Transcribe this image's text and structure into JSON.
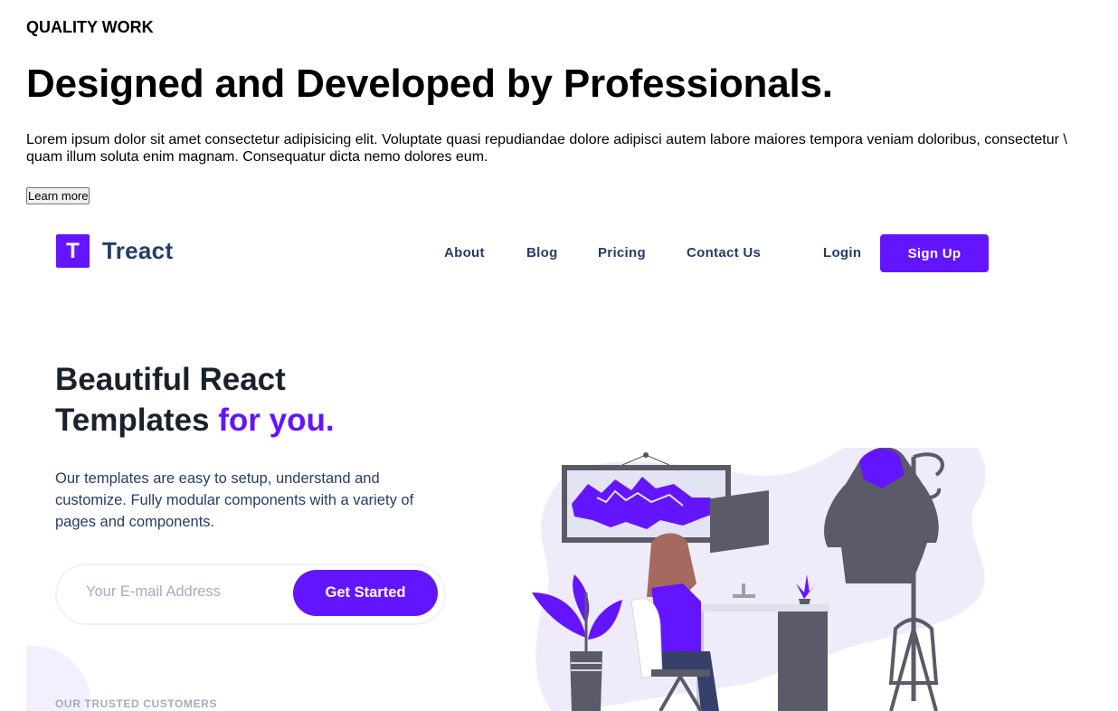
{
  "top": {
    "eyebrow": "QUALITY WORK",
    "heading": "Designed and Developed by Professionals.",
    "paragraph": "Lorem ipsum dolor sit amet consectetur adipisicing elit. Voluptate quasi repudiandae dolore adipisci autem labore maiores tempora veniam doloribus, consectetur \\ quam illum soluta enim magnam. Consequatur dicta nemo dolores eum.",
    "button": "Learn more"
  },
  "header": {
    "logo_letter": "T",
    "brand": "Treact",
    "nav": [
      "About",
      "Blog",
      "Pricing",
      "Contact Us"
    ],
    "login": "Login",
    "signup": "Sign Up"
  },
  "hero": {
    "title_line1": "Beautiful React",
    "title_line2": "Templates",
    "title_accent": "for you.",
    "description": "Our templates are easy to setup, understand and customize. Fully modular components with a variety of pages and components.",
    "email_placeholder": "Your E-mail Address",
    "cta": "Get Started",
    "trusted_label": "OUR TRUSTED CUSTOMERS"
  },
  "colors": {
    "accent": "#6415ff",
    "heading": "#1a202c",
    "nav_text": "#243e63",
    "muted": "#a0aec0",
    "blob": "#ede7fb"
  },
  "icons": {
    "logo": "letter-t-logo-icon",
    "illustration": "woman-at-desk-illustration"
  }
}
